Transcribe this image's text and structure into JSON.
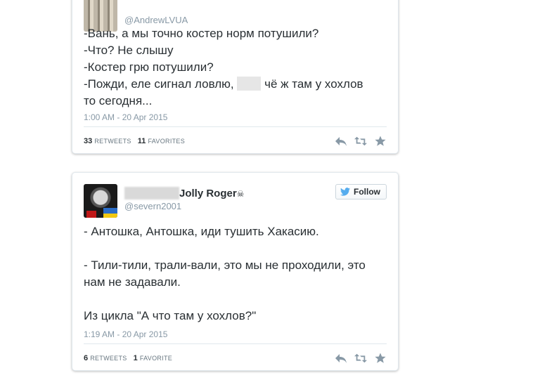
{
  "tweets": [
    {
      "handle": "@AndrewLVUA",
      "lines": [
        "-Вань, а мы точно костер норм потушили?",
        "-Что? Не слышу",
        "-Костер грю потушили?"
      ],
      "line4_before": "-Пожди, еле сигнал ловлю, ",
      "line4_after": " чё ж там у хохлов",
      "line5": "то сегодня...",
      "timestamp": "1:00 AM - 20 Apr 2015",
      "retweets_count": "33",
      "retweets_label": "RETWEETS",
      "favorites_count": "11",
      "favorites_label": "FAVORITES"
    },
    {
      "name": "Jolly Roger",
      "name_symbol": "☠",
      "handle": "@severn2001",
      "follow_label": "Follow",
      "paragraph1": "- Антошка, Антошка, иди тушить Хакасию.",
      "paragraph2": "- Тили-тили, трали-вали, это мы не проходили, это нам не задавали.",
      "paragraph3": "Из цикла \"А что там у хохлов?\"",
      "timestamp": "1:19 AM - 20 Apr 2015",
      "retweets_count": "6",
      "retweets_label": "RETWEETS",
      "favorites_count": "1",
      "favorites_label": "FAVORITE"
    }
  ],
  "colors": {
    "text": "#292f33",
    "muted": "#8899a6",
    "border": "#e1e8ed",
    "twitter_blue": "#55acee"
  }
}
